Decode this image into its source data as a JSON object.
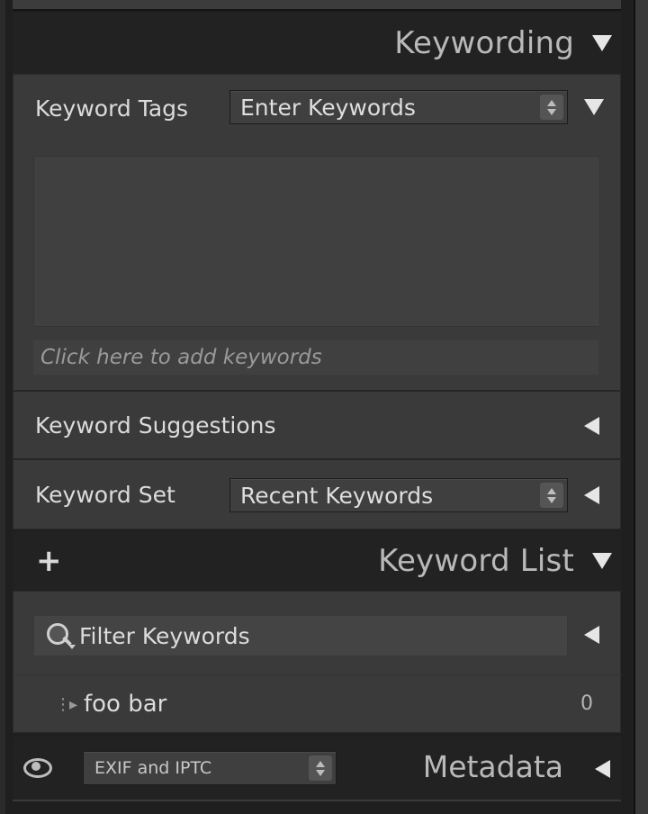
{
  "keywording": {
    "title": "Keywording",
    "keyword_tags_label": "Keyword Tags",
    "keyword_tags_mode": "Enter Keywords",
    "add_keywords_placeholder": "Click here to add keywords",
    "suggestions_label": "Keyword Suggestions",
    "keyword_set_label": "Keyword Set",
    "keyword_set_value": "Recent Keywords"
  },
  "keyword_list": {
    "title": "Keyword List",
    "add_symbol": "+",
    "filter_placeholder": "Filter Keywords",
    "items": [
      {
        "name": "foo bar",
        "count": "0"
      }
    ]
  },
  "metadata": {
    "title": "Metadata",
    "preset": "EXIF and IPTC"
  },
  "icons": {
    "collapse": "triangle-down-icon",
    "expand": "triangle-left-icon",
    "search": "search-icon",
    "visibility": "eye-icon",
    "add": "plus-icon"
  },
  "colors": {
    "panel_bg": "#222222",
    "section_bg": "#3a3a3a",
    "field_bg": "#404040",
    "text": "#dcdcdc",
    "title_text": "#b9b9b9"
  }
}
